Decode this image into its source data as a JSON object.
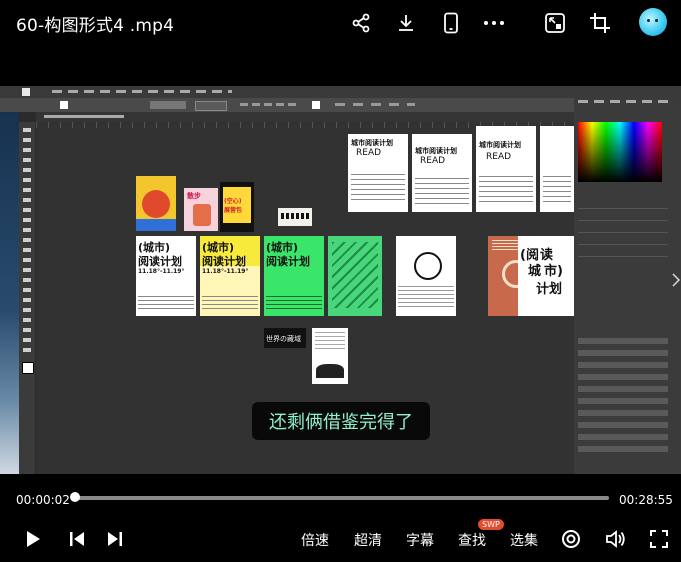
{
  "header": {
    "title": "60-构图形式4 .mp4",
    "icons": [
      "share-icon",
      "download-icon",
      "phone-icon",
      "more-icon",
      "pip-icon",
      "crop-icon",
      "avatar"
    ]
  },
  "video": {
    "subtitle": "还剩俩借鉴完得了",
    "posters": {
      "read1_title": "城市阅读计划",
      "read1_sub": "READ",
      "read2_title": "城市阅读计划",
      "read2_sub": "READ",
      "read3_title": "城市阅读计划",
      "read3_sub": "READ",
      "big1_title": "(城市)",
      "big1_sub": "阅读计划",
      "big1_date": "11.18°-11.19°",
      "big2_title": "(城市)",
      "big2_sub": "阅读计划",
      "big2_date": "11.18°-11.19°",
      "big3_title": "(城市)",
      "big3_sub": "阅读计划",
      "tall_title": "(阅",
      "tall_mid": "城",
      "tall_sub": "市)",
      "tall_end": "读",
      "tall_last": "计划",
      "book_title": "世界の藏域",
      "pink_title": "散步",
      "mid_title": "(空心)",
      "mid_sub": "展营包"
    }
  },
  "player": {
    "current_time": "00:00:02",
    "total_time": "00:28:55",
    "progress": 0.003,
    "speed_label": "倍速",
    "quality_label": "超清",
    "subtitle_label": "字幕",
    "search_label": "查找",
    "search_badge": "SWP",
    "episodes_label": "选集",
    "icons": [
      "play-icon",
      "prev-icon",
      "next-icon",
      "danmaku-icon",
      "volume-icon",
      "fullscreen-icon"
    ]
  },
  "colors": {
    "subtitle_text": "#8ff0ce",
    "poster_green": "#39e66a",
    "poster_yellow": "#f7ea3a",
    "poster_orange": "#c7694a"
  }
}
